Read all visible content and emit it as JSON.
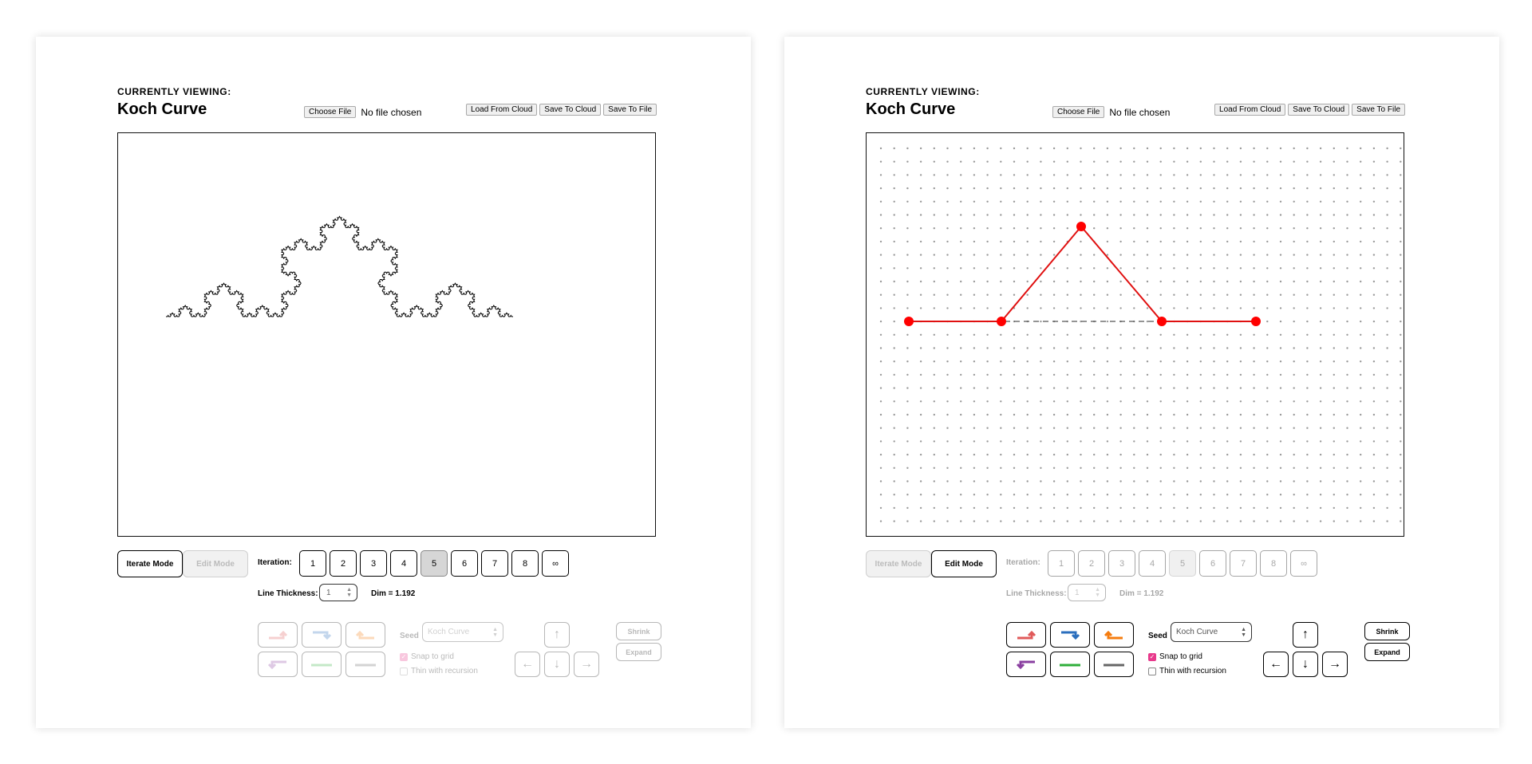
{
  "header": {
    "currently_viewing": "CURRENTLY VIEWING:",
    "title": "Koch Curve"
  },
  "file": {
    "choose_label": "Choose File",
    "status": "No file chosen"
  },
  "cloud": {
    "load": "Load From Cloud",
    "save_cloud": "Save To Cloud",
    "save_file": "Save To File"
  },
  "modes": {
    "iterate": "Iterate Mode",
    "edit": "Edit Mode"
  },
  "iteration": {
    "label": "Iteration:",
    "options": [
      "1",
      "2",
      "3",
      "4",
      "5",
      "6",
      "7",
      "8",
      "∞"
    ],
    "selected": "5"
  },
  "line_thickness": {
    "label": "Line Thickness:",
    "value": "1"
  },
  "dimension": "Dim = 1.192",
  "seed": {
    "label": "Seed",
    "value": "Koch Curve"
  },
  "options": {
    "snap": "Snap to grid",
    "thin": "Thin with recursion",
    "snap_checked": true,
    "thin_checked": false
  },
  "size_controls": {
    "shrink": "Shrink",
    "expand": "Expand"
  },
  "direction_buttons": [
    {
      "name": "up-right",
      "color": "#e05a5a"
    },
    {
      "name": "right-down",
      "color": "#2a6ebd"
    },
    {
      "name": "left-up",
      "color": "#f57c0f"
    },
    {
      "name": "down-left",
      "color": "#8a3fa0"
    },
    {
      "name": "horizontal",
      "color": "#2fae3a"
    },
    {
      "name": "horizontal",
      "color": "#666666"
    }
  ],
  "colors": {
    "line": "#e01010",
    "points": "#ff0000",
    "grid": "#9a9a9a"
  },
  "left_panel": {
    "mode": "iterate"
  },
  "right_panel": {
    "mode": "edit"
  }
}
